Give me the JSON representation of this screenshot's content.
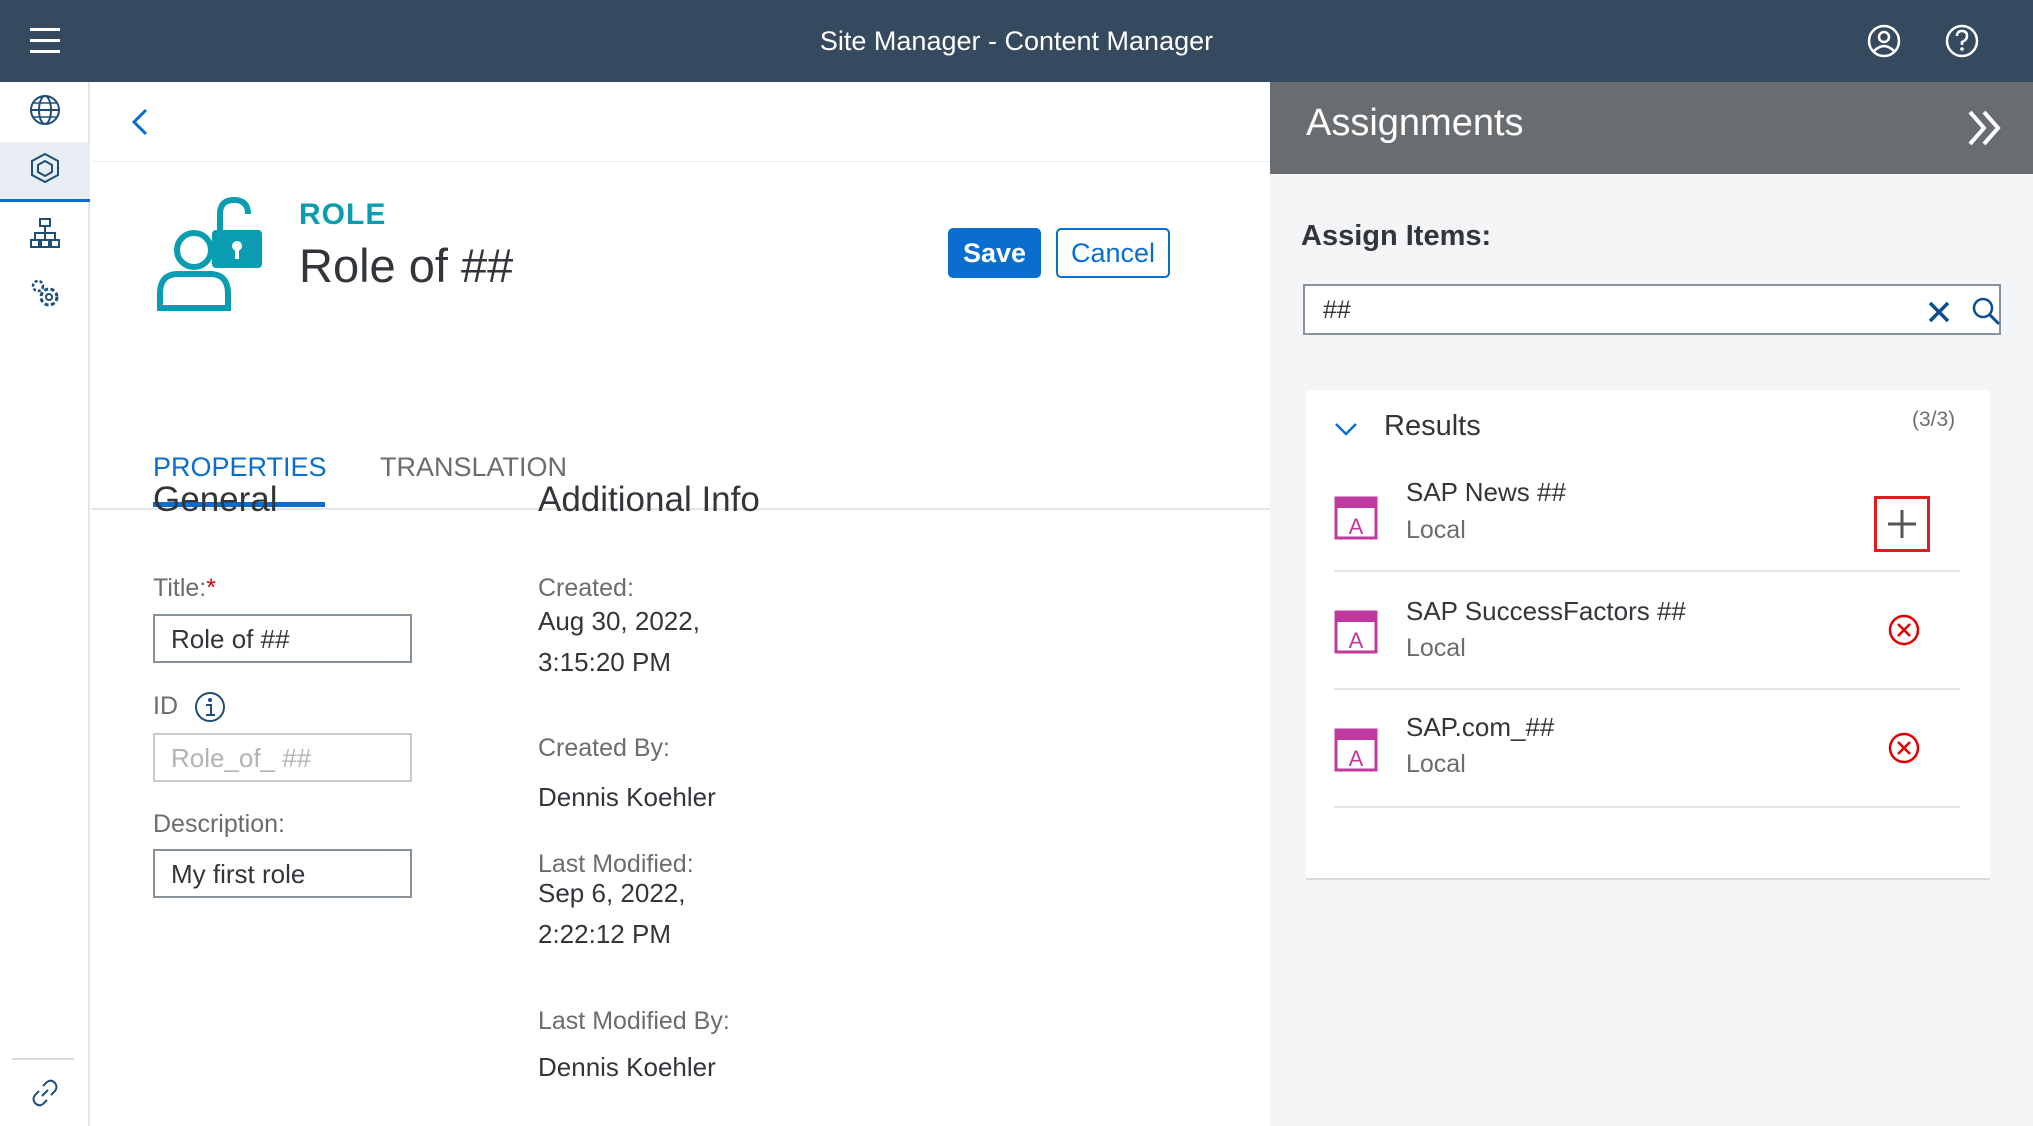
{
  "shell": {
    "title": "Site Manager - Content Manager",
    "menu_icon": "hamburger-menu-icon",
    "user_icon": "user-account-icon",
    "help_icon": "help-icon",
    "background": "#354a5f"
  },
  "sidenav": {
    "items": [
      {
        "icon": "globe-icon",
        "label": "sites"
      },
      {
        "icon": "cube-icon",
        "label": "content manager",
        "selected": true
      },
      {
        "icon": "hierarchy-icon",
        "label": "channel manager"
      },
      {
        "icon": "settings-icon",
        "label": "settings"
      }
    ],
    "bottom_icon": "link-icon"
  },
  "header": {
    "back_icon": "back-chevron-icon",
    "object_icon": "role-unlocked-icon",
    "kind": "ROLE",
    "title": "Role of ##",
    "save_label": "Save",
    "cancel_label": "Cancel"
  },
  "tabs": [
    {
      "label": "PROPERTIES",
      "active": true
    },
    {
      "label": "TRANSLATION",
      "active": false
    }
  ],
  "general": {
    "title": "General",
    "title_label": "Title:",
    "required_marker": "*",
    "title_value": "Role of ##",
    "id_label": "ID",
    "id_value": "Role_of_ ##",
    "description_label": "Description:",
    "description_value": "My first role"
  },
  "additional_info": {
    "title": "Additional Info",
    "created_label": "Created:",
    "created_value": "Aug 30, 2022,\n3:15:20 PM",
    "created_by_label": "Created By:",
    "created_by_value": "Dennis Koehler",
    "last_modified_label": "Last Modified:",
    "last_modified_value": "Sep 6, 2022,\n2:22:12 PM",
    "last_modified_by_label": "Last Modified By:",
    "last_modified_by_value": "Dennis Koehler"
  },
  "assignments": {
    "title": "Assignments",
    "collapse_icon": "double-chevron-right-icon",
    "assign_label": "Assign Items:",
    "search_value": "##",
    "results_label": "Results",
    "results_count": "(3/3)",
    "items": [
      {
        "name": "SAP News ##",
        "scope": "Local",
        "action": "add",
        "action_icon": "add-icon",
        "highlighted": true
      },
      {
        "name": "SAP SuccessFactors ##",
        "scope": "Local",
        "action": "remove",
        "action_icon": "remove-icon"
      },
      {
        "name": "SAP.com_##",
        "scope": "Local",
        "action": "remove",
        "action_icon": "remove-icon"
      }
    ]
  },
  "colors": {
    "accent": "#0a6ed1",
    "role_teal": "#0a9cb0",
    "app_icon_magenta": "#c0399f",
    "remove_red": "#e00000",
    "highlight_red": "#e02020",
    "panel_header": "#6a6d70"
  }
}
